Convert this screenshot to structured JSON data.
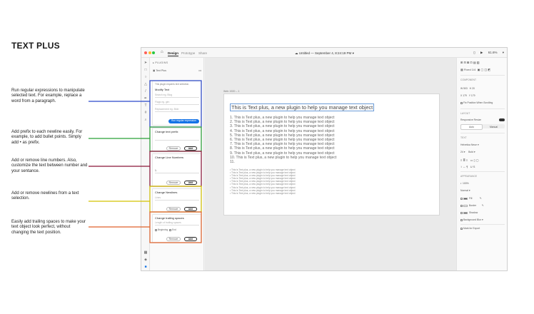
{
  "title": "TEXT PLUS",
  "annotations": [
    "Run regular expressions to manipulate selected text. For example, replace a word from a paragraph.",
    "Add prefix to each newline easily. For example, to add bullet points. Simply add • as prefix.",
    "Add or remove line numbers. Also, customize the text between number and your sentance.",
    "Add or remove newlines from a text selection.",
    "Easily add trailing spaces to make your text object look perfect, without changing the text position."
  ],
  "colors": {
    "blue": "#2a47c9",
    "green": "#29a036",
    "maroon": "#8a1538",
    "yellow": "#d4c400",
    "orange": "#e0622a"
  },
  "app": {
    "tabs": [
      "Design",
      "Prototype",
      "Share"
    ],
    "doc_title": "Untitled — September 4, 8:24:19 PM",
    "zoom": "61.6%",
    "home_icon": "home-icon"
  },
  "plugin_panel": {
    "header": "PLUGINS",
    "plugin_name": "Text Plus",
    "regex": {
      "hint": "This plugin requires text selection.",
      "title": "Modify Text",
      "field1": "Search eg. Blog",
      "field2": "Flags eg. gim",
      "field3": "Replacement eg. Blob",
      "button": "Run regular expression"
    },
    "prefix": {
      "title": "Change text prefix",
      "remove": "Remove",
      "add": "Add"
    },
    "line_numbers": {
      "title": "Change Line Numbers",
      "field": "1.",
      "remove": "Remove",
      "add": "Add"
    },
    "newlines": {
      "title": "Change Newlines",
      "field": "Lines",
      "remove": "Remove",
      "add": "Add"
    },
    "trailing": {
      "title": "Change trailing spaces",
      "field": "Length of trailing spaces",
      "opt1": "Beginning",
      "opt2": "End",
      "remove": "Remove",
      "add": "Add"
    }
  },
  "canvas": {
    "artboard_label": "Web 1920 – 1",
    "heading": "This is Text plus, a new plugin to help you manage text object",
    "list": [
      "1. This is Text plus, a new plugin to help you manage text object",
      "2. This is Text plus, a new plugin to help you manage text object",
      "3. This is Text plus, a new plugin to help you manage text object",
      "4. This is Text plus, a new plugin to help you manage text object",
      "5. This is Text plus, a new plugin to help you manage text object",
      "6. This is Text plus, a new plugin to help you manage text object",
      "7. This is Text plus, a new plugin to help you manage text object",
      "8. This is Text plus, a new plugin to help you manage text object",
      "9. This is Text plus, a new plugin to help you manage text object",
      "10. This is Text plus, a new plugin to help you manage text object",
      "11."
    ],
    "bullets": [
      "• This is Text plus, a new plugin to help you manage text object",
      "• This is Text plus, a new plugin to help you manage text object",
      "• This is Text plus, a new plugin to help you manage text object",
      "• This is Text plus, a new plugin to help you manage text object",
      "• This is Text plus, a new plugin to help you manage text object",
      "• This is Text plus, a new plugin to help you manage text object",
      "• This is Text plus, a new plugin to help you manage text object",
      "• This is Text plus, a new plugin to help you manage text object",
      "• This is Text plus, a new plugin to help you manage text object"
    ]
  },
  "right_panel": {
    "fixed_label": "Fixed 1/4",
    "component_label": "COMPONENT",
    "w_label": "W",
    "w_value": "503",
    "h_label": "H",
    "h_value": "20",
    "x_label": "X",
    "x_value": "179",
    "y_label": "Y",
    "y_value": "179",
    "fix_scroll": "Fix Position When Scrolling",
    "layout_label": "LAYOUT",
    "responsive": "Responsive Resize",
    "auto": "Auto",
    "manual": "Manual",
    "text_label": "TEXT",
    "font": "Helvetica Neue",
    "font_size": "24",
    "font_weight": "Bold",
    "appearance_label": "APPEARANCE",
    "opacity": "100%",
    "blend": "Normal",
    "fill": "Fill",
    "border": "Border",
    "shadow": "Shadow",
    "bg_blur": "Background Blur",
    "mark_export": "Mark for Export"
  }
}
